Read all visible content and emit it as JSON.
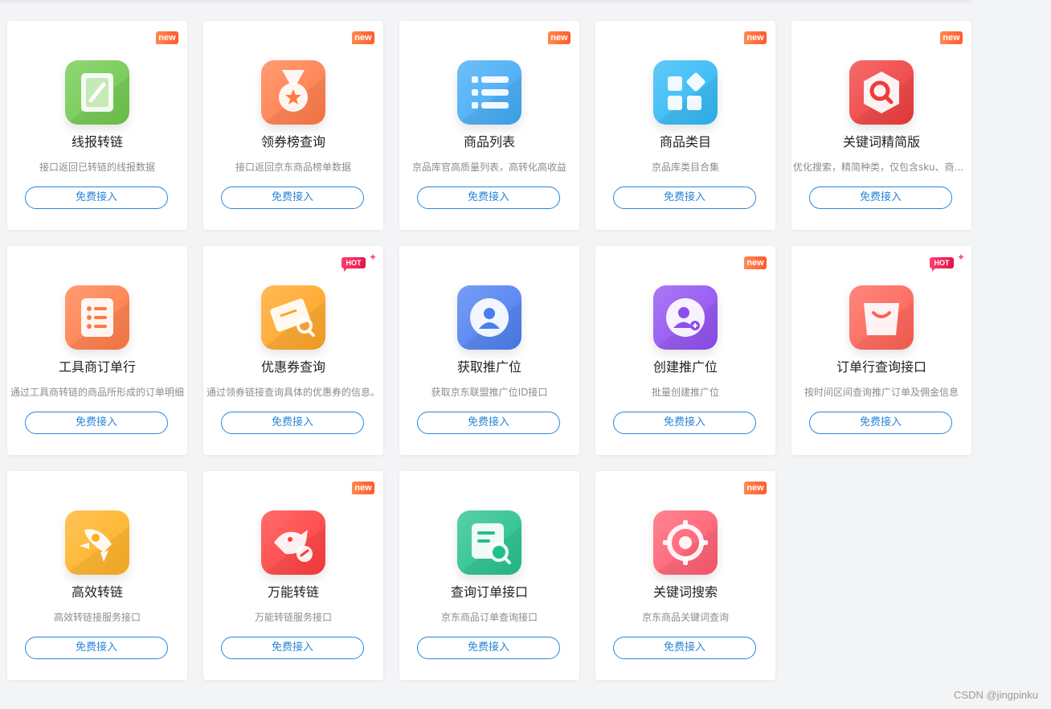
{
  "cards": [
    {
      "title": "线报转链",
      "desc": "接口返回已转链的线报数据",
      "badge": "new",
      "button": "免费接入",
      "icon": "link-icon",
      "color": "#6cc84a"
    },
    {
      "title": "领券榜查询",
      "desc": "接口返回京东商品榜单数据",
      "badge": "new",
      "button": "免费接入",
      "icon": "medal-icon",
      "color": "#ff7a45"
    },
    {
      "title": "商品列表",
      "desc": "京品库官高质量列表，高转化高收益",
      "badge": "new",
      "button": "免费接入",
      "icon": "list-icon",
      "color": "#3fa9f5"
    },
    {
      "title": "商品类目",
      "desc": "京品库类目合集",
      "badge": "new",
      "button": "免费接入",
      "icon": "category-icon",
      "color": "#2db7f5"
    },
    {
      "title": "关键词精简版",
      "desc": "优化搜索，精简种类，仅包含sku、商品...",
      "badge": "new",
      "button": "免费接入",
      "icon": "search-icon",
      "color": "#f03a3a"
    },
    {
      "title": "工具商订单行",
      "desc": "通过工具商转链的商品所形成的订单明细",
      "badge": "",
      "button": "免费接入",
      "icon": "document-icon",
      "color": "#ff7a45"
    },
    {
      "title": "优惠券查询",
      "desc": "通过领券链接查询具体的优惠券的信息。",
      "badge": "HOT",
      "button": "免费接入",
      "icon": "coupon-icon",
      "color": "#ffa320"
    },
    {
      "title": "获取推广位",
      "desc": "获取京东联盟推广位ID接口",
      "badge": "",
      "button": "免费接入",
      "icon": "user-icon",
      "color": "#4a7df0"
    },
    {
      "title": "创建推广位",
      "desc": "批量创建推广位",
      "badge": "new",
      "button": "免费接入",
      "icon": "add-user-icon",
      "color": "#8f4cf0"
    },
    {
      "title": "订单行查询接口",
      "desc": "按时间区间查询推广订单及佣金信息",
      "badge": "HOT",
      "button": "免费接入",
      "icon": "bag-icon",
      "color": "#ff5f52"
    },
    {
      "title": "高效转链",
      "desc": "高效转链接服务接口",
      "badge": "",
      "button": "免费接入",
      "icon": "rocket-icon",
      "color": "#ffb020"
    },
    {
      "title": "万能转链",
      "desc": "万能转链服务接口",
      "badge": "new",
      "button": "免费接入",
      "icon": "dog-link-icon",
      "color": "#ff3b3b"
    },
    {
      "title": "查询订单接口",
      "desc": "京东商品订单查询接口",
      "badge": "",
      "button": "免费接入",
      "icon": "order-search-icon",
      "color": "#22c08a"
    },
    {
      "title": "关键词搜索",
      "desc": "京东商品关键词查询",
      "badge": "new",
      "button": "免费接入",
      "icon": "target-icon",
      "color": "#ff5a6e"
    }
  ],
  "watermark": "CSDN @jingpinku"
}
